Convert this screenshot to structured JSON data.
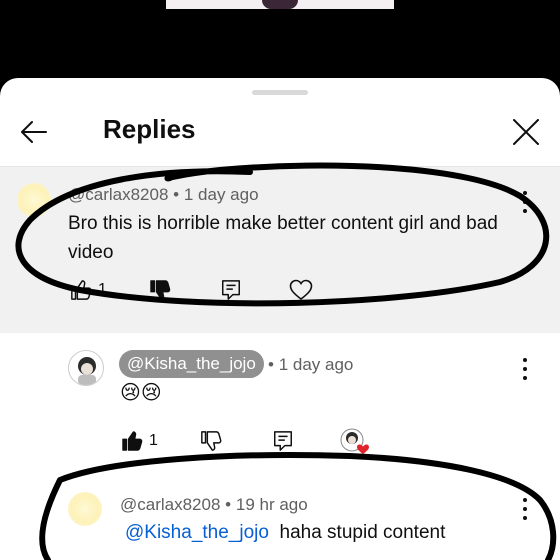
{
  "header": {
    "title": "Replies"
  },
  "parent_comment": {
    "author": "@carlax8208",
    "age": "1 day ago",
    "separator": "•",
    "text": "Bro this is horrible make better content girl and bad video",
    "like_count": "1"
  },
  "reply_1": {
    "author": "@Kisha_the_jojo",
    "age": "1 day ago",
    "separator": "•",
    "emojis": "😢😢",
    "like_count": "1"
  },
  "reply_2": {
    "author": "@carlax8208",
    "age": "19 hr ago",
    "separator": "•",
    "mention": "@Kisha_the_jojo",
    "text": "haha stupid content"
  },
  "colors": {
    "mention": "#065fd4",
    "scribble": "#000000",
    "heart_badge": "#e0242b"
  },
  "icons": [
    "back-arrow-icon",
    "close-icon",
    "more-vert-icon",
    "thumb-up-icon",
    "thumb-down-icon",
    "reply-icon",
    "heart-icon"
  ]
}
